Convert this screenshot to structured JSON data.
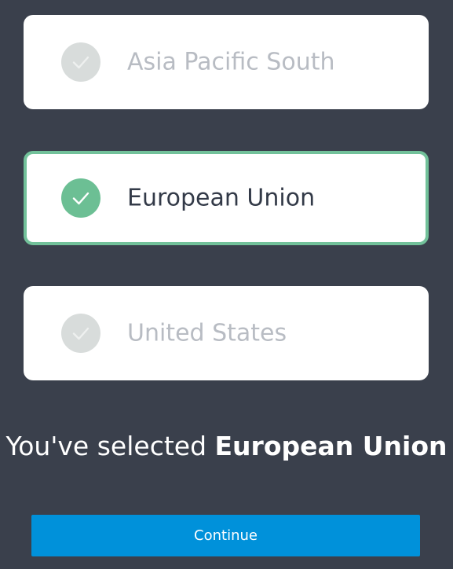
{
  "regions": [
    {
      "label": "Asia Pacific South",
      "selected": false
    },
    {
      "label": "European Union",
      "selected": true
    },
    {
      "label": "United States",
      "selected": false
    }
  ],
  "summary": {
    "prefix": "You've selected ",
    "selected_region": "European Union"
  },
  "continue_button": {
    "label": "Continue"
  },
  "colors": {
    "background": "#3a404c",
    "selected_border": "#72c19a",
    "selected_check": "#6cbf94",
    "unselected_check": "#d8dcdb",
    "button": "#0091da"
  },
  "icons": {
    "check": "check-icon"
  }
}
